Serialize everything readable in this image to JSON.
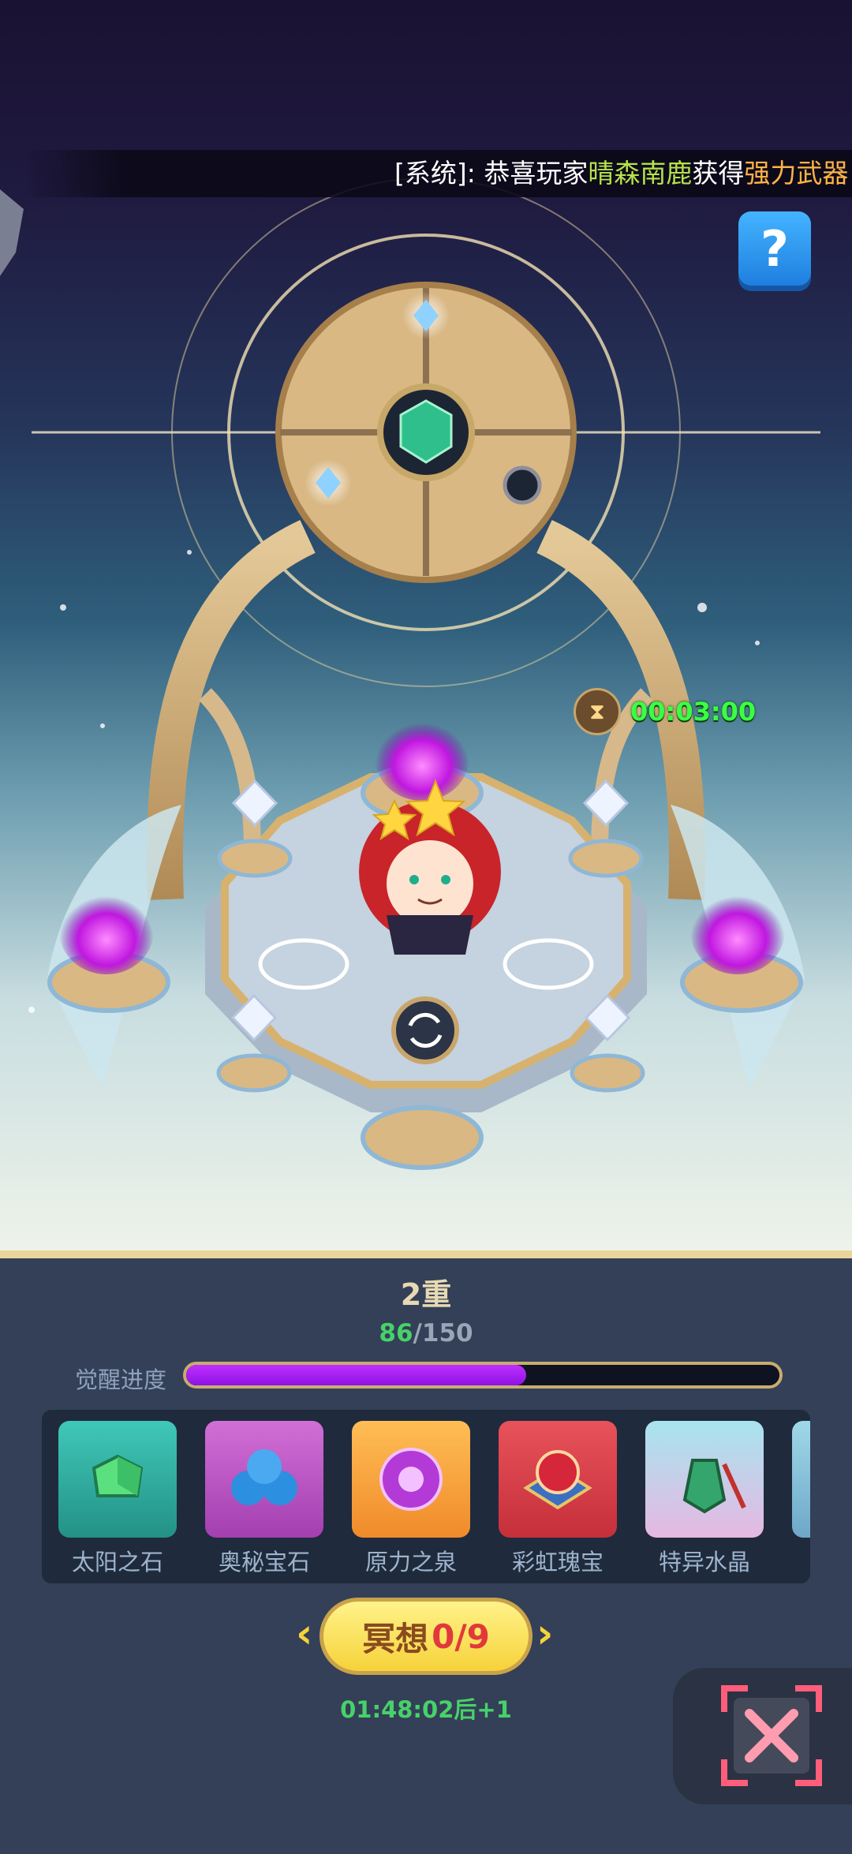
{
  "ticker": {
    "prefix": "[系统]: 恭喜玩家",
    "player": "晴森南鹿",
    "verb": "获得",
    "item": "强力武器"
  },
  "help": {
    "icon": "question-icon",
    "label": "?"
  },
  "timer": {
    "icon": "hourglass-icon",
    "value": "00:03:00"
  },
  "level": {
    "title": "2重"
  },
  "progress": {
    "current": "86",
    "max": "/150",
    "label": "觉醒进度",
    "fraction": 0.5733
  },
  "items": [
    {
      "name": "太阳之石",
      "icon": "green-gem-icon",
      "color": "#2fb0a6"
    },
    {
      "name": "奥秘宝石",
      "icon": "blue-orbs-icon",
      "color": "#c257c8"
    },
    {
      "name": "原力之泉",
      "icon": "purple-orb-icon",
      "color": "#f7a43a"
    },
    {
      "name": "彩虹瑰宝",
      "icon": "red-emblem-icon",
      "color": "#dc3c46"
    },
    {
      "name": "特异水晶",
      "icon": "crystal-bottle-icon",
      "color": "#8fd8e6"
    }
  ],
  "meditate": {
    "label": "冥想",
    "count": "0/9"
  },
  "countdown": "01:48:02后+1",
  "close": {
    "icon": "close-icon"
  },
  "colors": {
    "progress": "#b020f5",
    "panel": "#334057",
    "accent_green": "#48d16a",
    "button_yellow": "#f6d23a"
  }
}
